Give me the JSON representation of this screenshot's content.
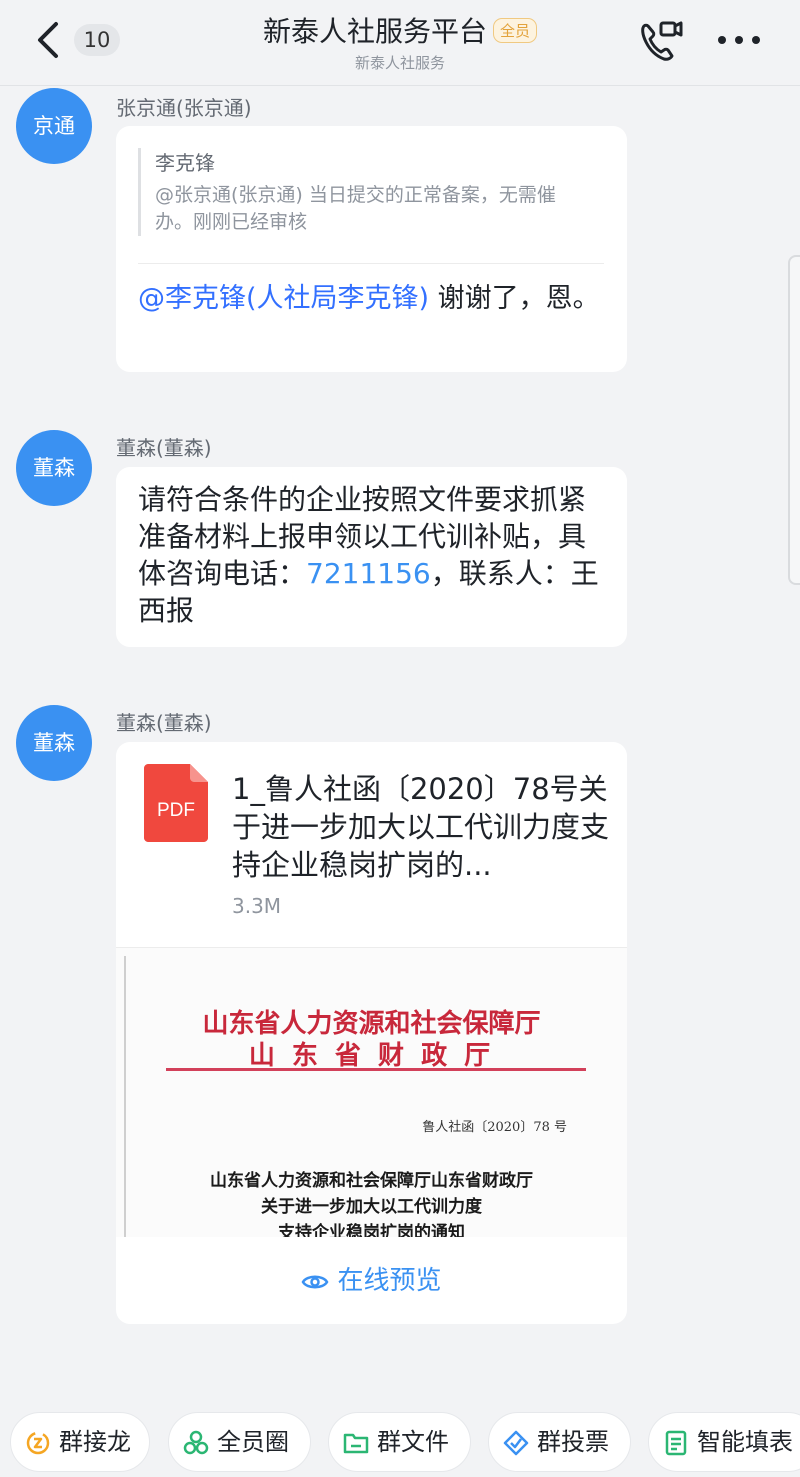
{
  "header": {
    "back_count": "10",
    "title": "新泰人社服务平台",
    "tag": "全员",
    "subtitle": "新泰人社服务"
  },
  "messages": [
    {
      "avatar": "京通",
      "sender": "张京通(张京通)",
      "quote_author": "李克锋",
      "quote_text": "@张京通(张京通) 当日提交的正常备案，无需催办。刚刚已经审核",
      "mention": "@李克锋(人社局李克锋)",
      "reply": " 谢谢了，恩。"
    },
    {
      "avatar": "董森",
      "sender": "董森(董森)",
      "text_before": "请符合条件的企业按照文件要求抓紧准备材料上报申领以工代训补贴，具体咨询电话：",
      "phone": "7211156",
      "text_after": "，联系人：王西报"
    },
    {
      "avatar": "董森",
      "sender": "董森(董森)",
      "file_icon_label": "PDF",
      "file_name": "1_鲁人社函〔2020〕78号关于进一步加大以工代训力度支持企业稳岗扩岗的...",
      "file_size": "3.3M",
      "preview": {
        "head_line1": "山东省人力资源和社会保障厅",
        "head_line2": "山 东 省 财 政 厅",
        "doc_number": "鲁人社函〔2020〕78 号",
        "doc_title_1": "山东省人力资源和社会保障厅山东省财政厅",
        "doc_title_2": "关于进一步加大以工代训力度",
        "doc_title_3": "支持企业稳岗扩岗的通知"
      },
      "preview_link": "在线预览"
    }
  ],
  "toolbar": [
    {
      "label": "群接龙",
      "icon": "relay-icon"
    },
    {
      "label": "全员圈",
      "icon": "circle-icon"
    },
    {
      "label": "群文件",
      "icon": "folder-icon"
    },
    {
      "label": "群投票",
      "icon": "vote-icon"
    },
    {
      "label": "智能填表",
      "icon": "form-icon"
    }
  ],
  "colors": {
    "accent": "#3a91f2",
    "mention": "#3370ff",
    "pdf": "#f0483e",
    "doc_red": "#c8283b"
  }
}
